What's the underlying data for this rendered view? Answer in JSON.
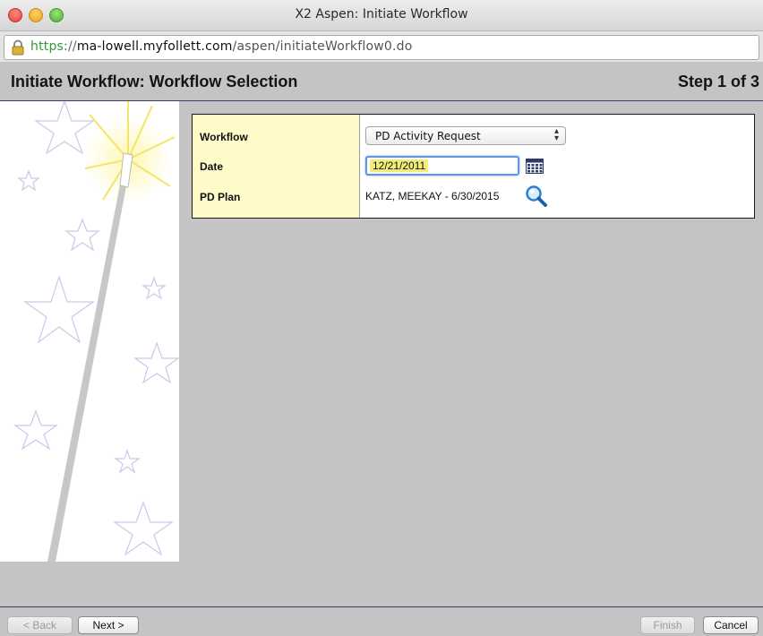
{
  "window": {
    "title": "X2 Aspen: Initiate Workflow"
  },
  "url": {
    "scheme": "https",
    "separator": "://",
    "host": "ma-lowell.myfollett.com",
    "path": "/aspen/initiateWorkflow0.do"
  },
  "header": {
    "title": "Initiate Workflow: Workflow Selection",
    "step": "Step 1 of 3"
  },
  "form": {
    "workflow": {
      "label": "Workflow",
      "value": "PD Activity Request"
    },
    "date": {
      "label": "Date",
      "value": "12/21/2011"
    },
    "pd_plan": {
      "label": "PD Plan",
      "value": "KATZ, MEEKAY - 6/30/2015"
    }
  },
  "footer": {
    "back_label": "< Back",
    "next_label": "Next >",
    "finish_label": "Finish",
    "cancel_label": "Cancel"
  },
  "icons": {
    "lock": "lock-icon",
    "calendar": "calendar-icon",
    "search": "magnifier-icon"
  },
  "colors": {
    "label_column": "#fffbc8",
    "date_highlight": "#f3ec79",
    "url_scheme": "#2f9c2f",
    "header_rule": "#3d3d6a"
  }
}
